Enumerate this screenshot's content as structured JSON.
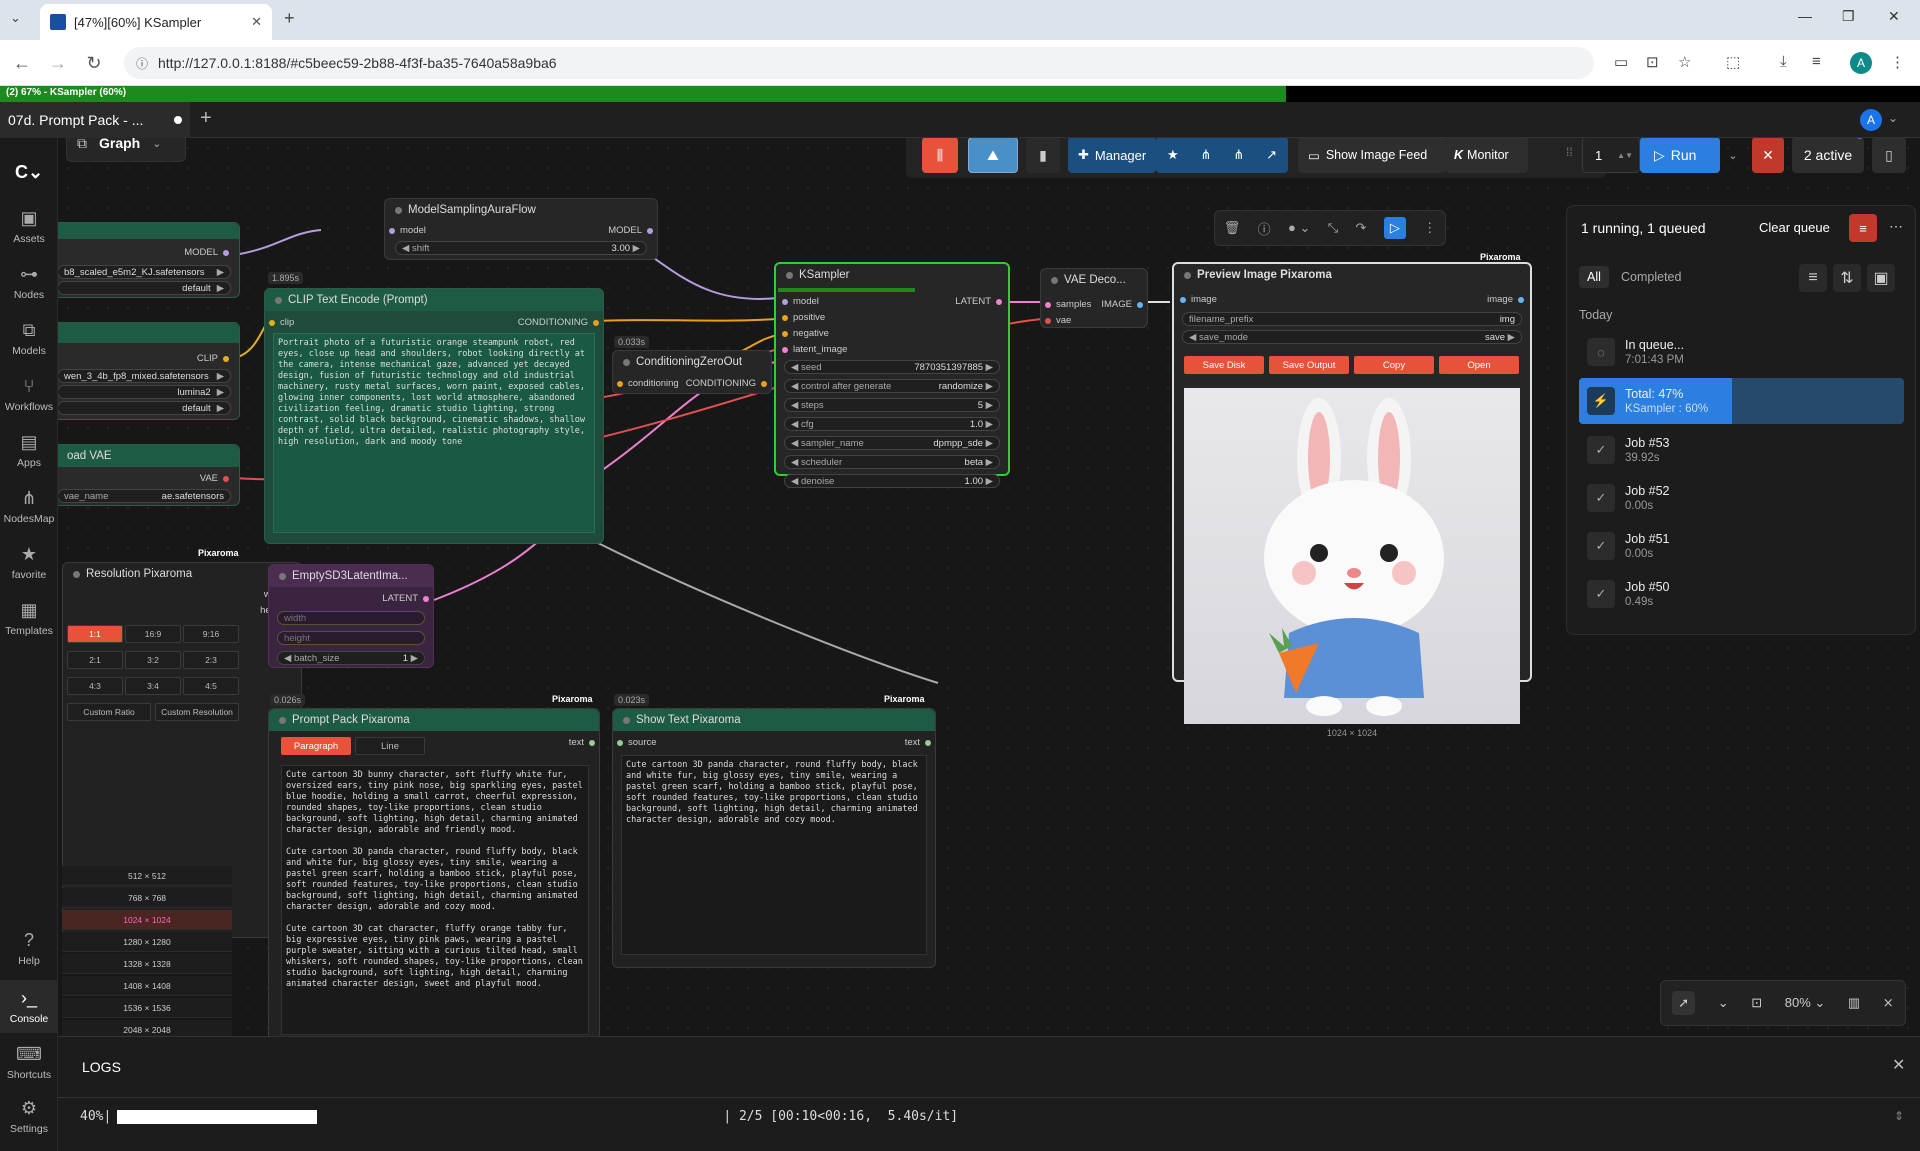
{
  "browser": {
    "tab_title": "[47%][60%] KSampler",
    "url": "http://127.0.0.1:8188/#c5beec59-2b88-4f3f-ba35-7640a58a9ba6",
    "profile_initial": "A"
  },
  "progress": {
    "label": "(2) 67% - KSampler (60%)",
    "fraction": 0.67
  },
  "workflow_tab": {
    "label": "07d. Prompt Pack - ...",
    "user_initial": "A"
  },
  "sidebar": [
    {
      "label": "Assets",
      "icon": "image-icon"
    },
    {
      "label": "Nodes",
      "icon": "nodes-icon"
    },
    {
      "label": "Models",
      "icon": "models-icon"
    },
    {
      "label": "Workflows",
      "icon": "workflows-icon"
    },
    {
      "label": "Apps",
      "icon": "apps-icon"
    },
    {
      "label": "NodesMap",
      "icon": "nodesmap-icon"
    },
    {
      "label": "favorite",
      "icon": "star-icon"
    },
    {
      "label": "Templates",
      "icon": "templates-icon"
    },
    {
      "label": "Help",
      "icon": "help-icon"
    },
    {
      "label": "Console",
      "icon": "console-icon"
    },
    {
      "label": "Shortcuts",
      "icon": "keyboard-icon"
    },
    {
      "label": "Settings",
      "icon": "gear-icon"
    }
  ],
  "graph_label": "Graph",
  "toolbar": {
    "manager": "Manager",
    "show_image_feed": "Show Image Feed",
    "monitor": "Monitor",
    "batch_count": "1",
    "run": "Run",
    "active": "2 active",
    "zoom": "80%"
  },
  "nodes": {
    "loader_model_out": "MODEL",
    "loader_unet": "b8_scaled_e5m2_KJ.safetensors",
    "loader_default1": "default",
    "clip_out": "CLIP",
    "clip_name": "wen_3_4b_fp8_mixed.safetensors",
    "clip_type": "lumina2",
    "clip_default": "default",
    "vae_title": "oad VAE",
    "vae_out": "VAE",
    "vae_name_label": "vae_name",
    "vae_name": "ae.safetensors",
    "msaf_title": "ModelSamplingAuraFlow",
    "msaf_in": "model",
    "msaf_out": "MODEL",
    "msaf_shift_label": "shift",
    "msaf_shift": "3.00",
    "clip_enc_time": "1.895s",
    "clip_enc_title": "CLIP Text Encode (Prompt)",
    "clip_enc_in": "clip",
    "clip_enc_out": "CONDITIONING",
    "clip_enc_text": "Portrait photo of a futuristic orange steampunk robot, red eyes, close up head and shoulders, robot looking directly at the camera, intense mechanical gaze, advanced yet decayed design, fusion of futuristic technology and old industrial machinery, rusty metal surfaces, worn paint, exposed cables, glowing inner components, lost world atmosphere, abandoned civilization feeling, dramatic studio lighting, strong contrast, solid black background, cinematic shadows, shallow depth of field, ultra detailed, realistic photography style, high resolution, dark and moody tone",
    "czo_time": "0.033s",
    "czo_title": "ConditioningZeroOut",
    "czo_in": "conditioning",
    "czo_out": "CONDITIONING",
    "ks_title": "KSampler",
    "ks_inputs": [
      "model",
      "positive",
      "negative",
      "latent_image"
    ],
    "ks_out": "LATENT",
    "ks_widgets": [
      {
        "label": "seed",
        "value": "787035139788​5"
      },
      {
        "label": "control after generate",
        "value": "randomize"
      },
      {
        "label": "steps",
        "value": "5"
      },
      {
        "label": "cfg",
        "value": "1.0"
      },
      {
        "label": "sampler_name",
        "value": "dpmpp_sde"
      },
      {
        "label": "scheduler",
        "value": "beta"
      },
      {
        "label": "denoise",
        "value": "1.00"
      }
    ],
    "ks_progress": 0.6,
    "vae_dec_title": "VAE Deco...",
    "vae_dec_in1": "samples",
    "vae_dec_in2": "vae",
    "vae_dec_out": "IMAGE",
    "preview_tag": "Pixaroma",
    "preview_title": "Preview Image Pixaroma",
    "preview_in": "image",
    "preview_out": "image",
    "preview_prefix_label": "filename_prefix",
    "preview_prefix": "img",
    "preview_mode_label": "save_mode",
    "preview_mode": "save",
    "preview_buttons": [
      "Save Disk",
      "Save Output",
      "Copy",
      "Open"
    ],
    "preview_size": "1024 × 1024",
    "res_tag": "Pixaroma",
    "res_title": "Resolution Pixaroma",
    "res_out1": "width",
    "res_out2": "height",
    "res_ratios": [
      "1:1",
      "16:9",
      "9:16",
      "2:1",
      "3:2",
      "2:3",
      "4:3",
      "3:4",
      "4:5"
    ],
    "res_custom_ratio": "Custom Ratio",
    "res_custom_res": "Custom Resolution",
    "res_sizes": [
      "512 × 512",
      "768 × 768",
      "1024 × 1024",
      "1280 × 1280",
      "1328 × 1328",
      "1408 × 1408",
      "1536 × 1536",
      "2048 × 2048"
    ],
    "empty_title": "EmptySD3LatentIma...",
    "empty_out": "LATENT",
    "empty_w": "width",
    "empty_h": "height",
    "empty_batch_label": "batch_size",
    "empty_batch": "1",
    "pp_time": "0.026s",
    "pp_tag": "Pixaroma",
    "pp_title": "Prompt Pack Pixaroma",
    "pp_out": "text",
    "pp_mode1": "Paragraph",
    "pp_mode2": "Line",
    "pp_text": "Cute cartoon 3D bunny character, soft fluffy white fur, oversized ears, tiny pink nose, big sparkling eyes, pastel blue hoodie, holding a small carrot, cheerful expression, rounded shapes, toy-like proportions, clean studio background, soft lighting, high detail, charming animated character design, adorable and friendly mood.\n\nCute cartoon 3D panda character, round fluffy body, black and white fur, big glossy eyes, tiny smile, wearing a pastel green scarf, holding a bamboo stick, playful pose, soft rounded features, toy-like proportions, clean studio background, soft lighting, high detail, charming animated character design, adorable and cozy mood.\n\nCute cartoon 3D cat character, fluffy orange tabby fur, big expressive eyes, tiny pink paws, wearing a pastel purple sweater, sitting with a curious tilted head, small whiskers, soft rounded shapes, toy-like proportions, clean studio background, soft lighting, high detail, charming animated character design, sweet and playful mood.",
    "st_time": "0.023s",
    "st_tag": "Pixaroma",
    "st_title": "Show Text Pixaroma",
    "st_in": "source",
    "st_out": "text",
    "st_text": "Cute cartoon 3D panda character, round fluffy body, black and white fur, big glossy eyes, tiny smile, wearing a pastel green scarf, holding a bamboo stick, playful pose, soft rounded features, toy-like proportions, clean studio background, soft lighting, high detail, charming animated character design, adorable and cozy mood."
  },
  "queue": {
    "header": "1 running, 1 queued",
    "clear": "Clear queue",
    "tab_all": "All",
    "tab_completed": "Completed",
    "group": "Today",
    "items": [
      {
        "title": "In queue...",
        "sub": "7:01:43 PM"
      },
      {
        "title": "Total: 47%",
        "sub": "KSampler : 60%"
      },
      {
        "title": "Job #53",
        "sub": "39.92s"
      },
      {
        "title": "Job #52",
        "sub": "0.00s"
      },
      {
        "title": "Job #51",
        "sub": "0.00s"
      },
      {
        "title": "Job #50",
        "sub": "0.49s"
      }
    ],
    "total_fraction": 0.47,
    "ksampler_fraction": 0.6
  },
  "logs": {
    "title": "LOGS",
    "percent": "40%|",
    "progress_fraction": 0.4,
    "rest": "| 2/5 [00:10<00:16,  5.40s/it]"
  },
  "colors": {
    "accent": "#1a73e8",
    "node_green": "#1e5b45",
    "orange": "#e8513a",
    "run_blue": "#2a7fe0"
  }
}
